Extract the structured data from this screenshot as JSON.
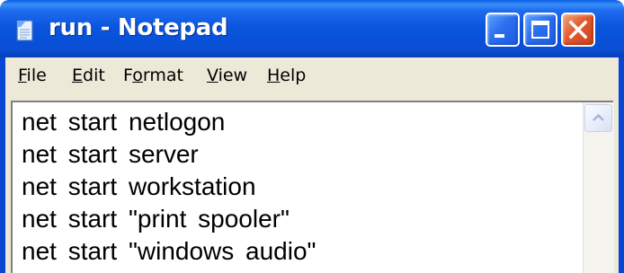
{
  "window": {
    "title": "run - Notepad",
    "controls": {
      "minimize_icon": "minimize-icon",
      "maximize_icon": "maximize-icon",
      "close_icon": "close-icon"
    },
    "colors": {
      "titlebar": "#0a55dc",
      "close_button": "#e35a2e",
      "menubar": "#ece9d8"
    }
  },
  "menu": {
    "items": [
      {
        "accel": "F",
        "rest": "ile"
      },
      {
        "accel": "E",
        "rest": "dit"
      },
      {
        "pre": "F",
        "accel": "o",
        "rest": "rmat"
      },
      {
        "accel": "V",
        "rest": "iew"
      },
      {
        "accel": "H",
        "rest": "elp"
      }
    ]
  },
  "document": {
    "lines": [
      "net start netlogon",
      "net start server",
      "net start workstation",
      "net start \"print spooler\"",
      "net start \"windows audio\""
    ]
  },
  "scrollbar": {
    "up_icon": "scroll-up-arrow-icon"
  }
}
